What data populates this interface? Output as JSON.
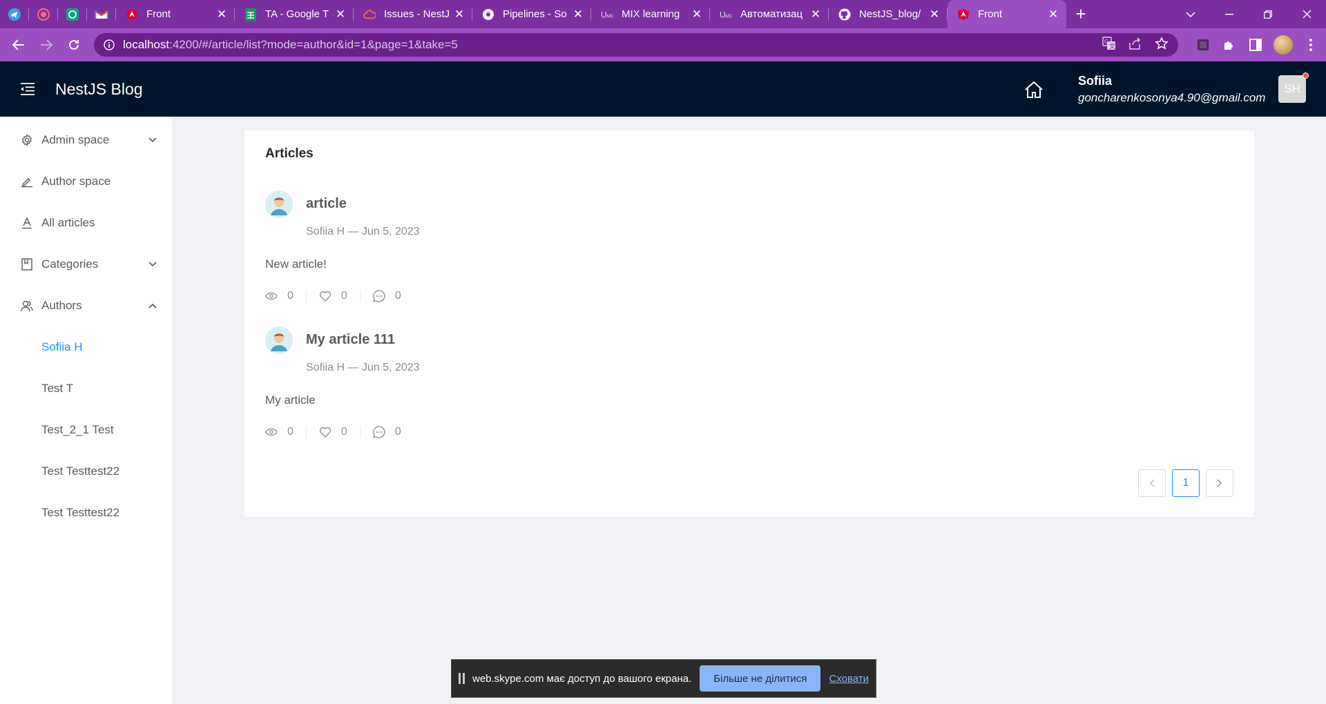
{
  "browser": {
    "pinned_tabs": [
      {
        "icon": "telegram-icon"
      },
      {
        "icon": "record-icon"
      },
      {
        "icon": "openai-icon"
      },
      {
        "icon": "gmail-icon"
      }
    ],
    "tabs": [
      {
        "title": "Front",
        "icon": "angular-icon"
      },
      {
        "title": "TA - Google T",
        "icon": "google-sheets-icon"
      },
      {
        "title": "Issues - NestJ",
        "icon": "cloud-icon"
      },
      {
        "title": "Pipelines - So",
        "icon": "circleci-icon"
      },
      {
        "title": "MIX learning",
        "icon": "mix-icon"
      },
      {
        "title": "Автоматизац",
        "icon": "mix-icon"
      },
      {
        "title": "NestJS_blog/",
        "icon": "github-icon"
      },
      {
        "title": "Front",
        "icon": "angular-icon"
      }
    ],
    "active_tab_index": 7,
    "url_host": "localhost",
    "url_rest": ":4200/#/article/list?mode=author&id=1&page=1&take=5"
  },
  "header": {
    "brand": "NestJS Blog",
    "user_name": "Sofiia",
    "user_email": "goncharenkosonya4.90@gmail.com",
    "avatar_initials": "SH"
  },
  "sidebar": {
    "items": [
      {
        "label": "Admin space",
        "icon": "gear-icon",
        "chevron": "down"
      },
      {
        "label": "Author space",
        "icon": "edit-icon",
        "chevron": ""
      },
      {
        "label": "All articles",
        "icon": "font-icon",
        "chevron": ""
      },
      {
        "label": "Categories",
        "icon": "book-icon",
        "chevron": "down"
      },
      {
        "label": "Authors",
        "icon": "team-icon",
        "chevron": "up"
      }
    ],
    "authors": [
      {
        "label": "Sofiia H",
        "selected": true
      },
      {
        "label": "Test T",
        "selected": false
      },
      {
        "label": "Test_2_1 Test",
        "selected": false
      },
      {
        "label": "Test Testtest22",
        "selected": false
      },
      {
        "label": "Test Testtest22",
        "selected": false
      }
    ]
  },
  "main": {
    "title": "Articles",
    "articles": [
      {
        "title": "article",
        "author": "Sofiia H",
        "date": "Jun 5, 2023",
        "meta": "Sofiia H — Jun 5, 2023",
        "body": "New article!",
        "views": "0",
        "likes": "0",
        "comments": "0"
      },
      {
        "title": "My article 111",
        "author": "Sofiia H",
        "date": "Jun 5, 2023",
        "meta": "Sofiia H — Jun 5, 2023",
        "body": "My article",
        "views": "0",
        "likes": "0",
        "comments": "0"
      }
    ],
    "pagination": {
      "current": "1",
      "prev": "<",
      "next": ">"
    }
  },
  "share_bar": {
    "message": "web.skype.com має доступ до вашого екрана.",
    "stop_label": "Більше не ділитися",
    "hide_label": "Сховати"
  },
  "colors": {
    "browser_frame": "#7b2fa0",
    "header_bg": "#001529",
    "accent": "#1890ff"
  }
}
